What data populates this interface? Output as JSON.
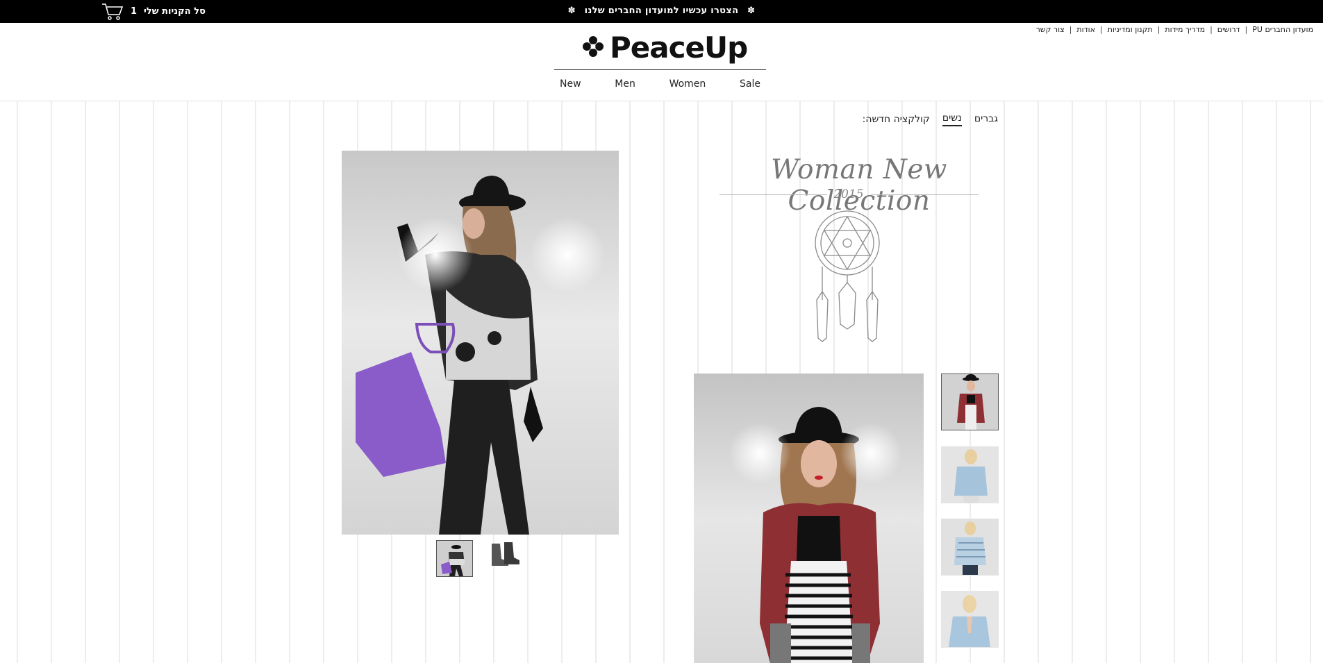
{
  "topbar": {
    "promo_text": "הצטרו עכשיו למועדון החברים שלנו",
    "star_glyph": "✽",
    "cart_label": "סל הקניות שלי",
    "cart_count": "1",
    "background": "#000000"
  },
  "utility_links": [
    "צור קשר",
    "אודות",
    "תקנון ומדיניות",
    "מדריך מידות",
    "דרושים",
    "מועדון החברים PU"
  ],
  "header": {
    "logo_text": "PeaceUp",
    "logo_icon": "flower-icon",
    "nav": [
      "New",
      "Men",
      "Women",
      "Sale"
    ]
  },
  "collection": {
    "label": "קולקציה חדשה:",
    "tabs": [
      {
        "label": "נשים",
        "active": true
      },
      {
        "label": "גברים",
        "active": false
      }
    ]
  },
  "banner": {
    "title": "Woman New Collection",
    "year": "2015",
    "emblem": "dreamcatcher-icon"
  },
  "colors": {
    "accent": "#000000",
    "pattern": "#ececf1",
    "bag": "#8a5cc9",
    "jacket": "#8e2f34"
  }
}
